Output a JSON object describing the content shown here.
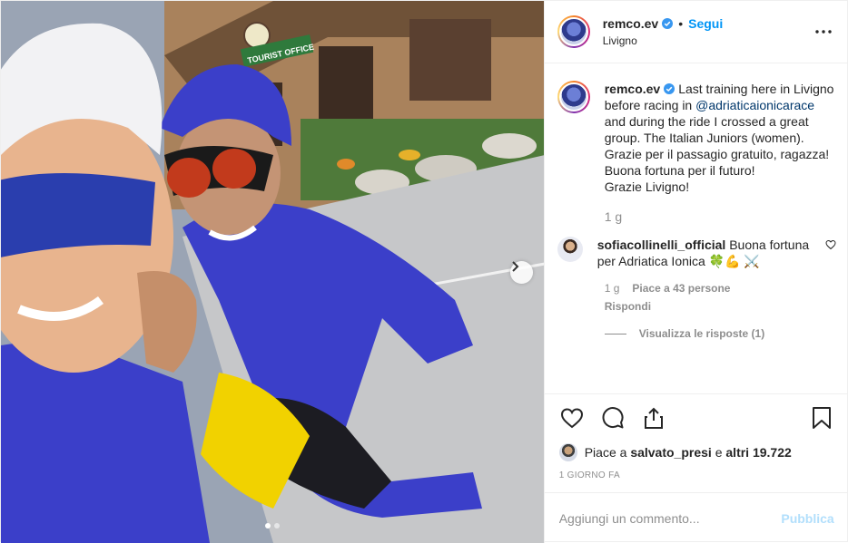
{
  "post": {
    "photo": {
      "sign_text": "TOURIST OFFICE",
      "carousel_dots": 2,
      "active_dot": 0,
      "next_icon": "chevron-right-icon"
    },
    "header": {
      "username": "remco.ev",
      "separator": "•",
      "follow_label": "Segui",
      "location": "Livigno",
      "more_icon": "more-horizontal-icon"
    },
    "caption": {
      "username": "remco.ev",
      "text_before": "Last training here in Livigno before racing in ",
      "mention": "@adriaticaionicarace",
      "text_after": " and during the ride I crossed a great group. The Italian Juniors (women).",
      "line2": "Grazie per il passagio gratuito, ragazza!",
      "line3": "Buona fortuna per il futuro!",
      "line4": "Grazie Livigno!",
      "time": "1 g"
    },
    "comment": {
      "username": "sofiacollinelli_official",
      "text": "Buona fortuna per Adriatica Ionica 🍀💪 ⚔️",
      "time": "1 g",
      "likes": "Piace a 43 persone",
      "reply_label": "Rispondi",
      "view_replies": "Visualizza le risposte (1)"
    },
    "actions": {
      "likes_prefix": "Piace a ",
      "likes_user": "salvato_presi",
      "likes_middle": " e ",
      "likes_count": "altri 19.722",
      "timestamp": "1 GIORNO FA"
    },
    "add_comment": {
      "placeholder": "Aggiungi un commento...",
      "publish_label": "Pubblica"
    },
    "colors": {
      "accent": "#0095f6",
      "verified": "#3897f0",
      "mention": "#00376b",
      "muted": "#8e8e8e",
      "publish_disabled": "#b2dffc",
      "jersey": "#3b3fc9"
    }
  }
}
